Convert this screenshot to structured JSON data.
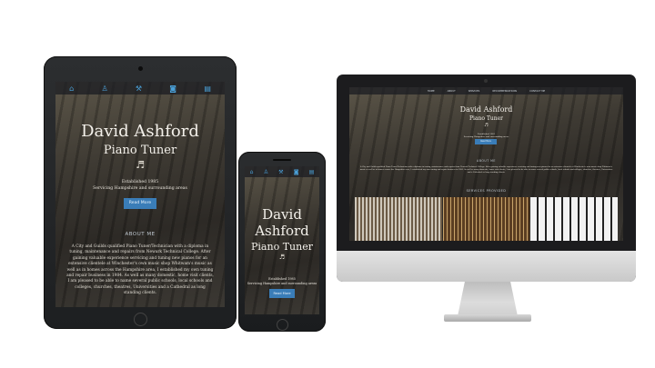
{
  "site": {
    "name": "David Ashford",
    "subtitle": "Piano Tuner",
    "established": "Established 1985",
    "servicing": "Servicing Hampshire and surrounding areas",
    "button": "Read More",
    "about_heading": "ABOUT ME",
    "services_heading": "SERVICES PROVIDED",
    "about_text": "A City and Guilds qualified Piano Tuner/Technician with a diploma in tuning, maintenance and repairs from Newark Technical College. After gaining valuable experience servicing and tuning new pianos for an extensive clientele at Winchester's own music shop Whitwam's music as well as in homes across the Hampshire area, I established my own tuning and repair business in 1984. As well as many domestic, home visit clients, I am pleased to be able to name several public schools, local schools and colleges, churches, theatres, Universities and a Cathedral as long standing clients.",
    "nav_icons": [
      "home-icon",
      "user-icon",
      "wrench-icon",
      "camera-icon",
      "mail-icon"
    ],
    "nav_glyphs": [
      "⌂",
      "♙",
      "⚒",
      "◙",
      "▤"
    ]
  },
  "imac_nav": [
    "HOME",
    "ABOUT",
    "SERVICES",
    "RECOMMENDATIONS",
    "CONTACT ME"
  ],
  "apple_logo": "",
  "piano_glyph": "♬",
  "colors": {
    "accent": "#3a7db8",
    "nav_icon": "#4aa0d8"
  }
}
